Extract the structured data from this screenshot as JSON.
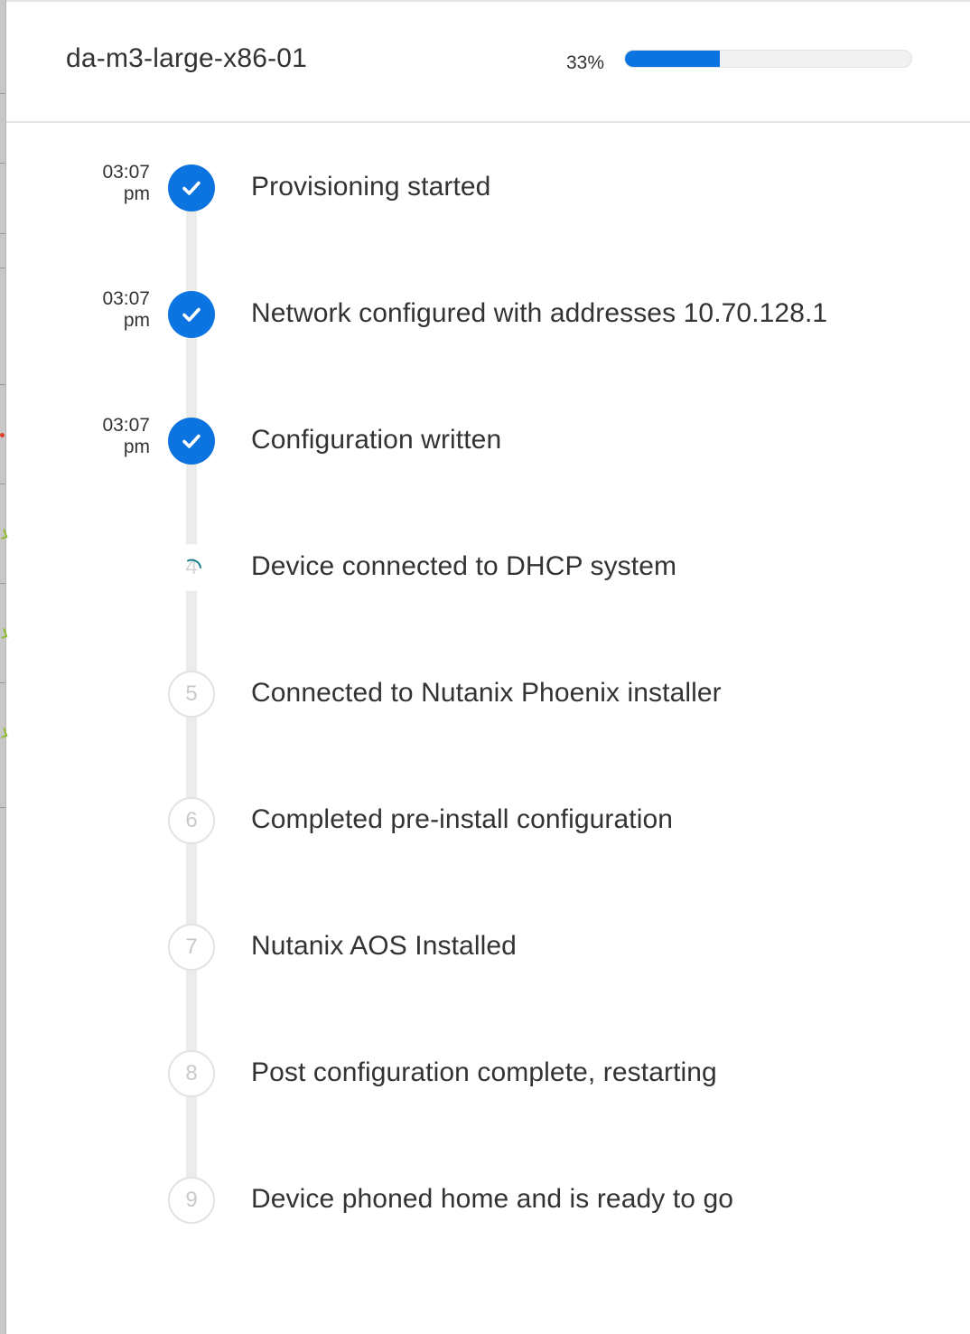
{
  "panel": {
    "device_name": "da-m3-large-x86-01",
    "progress": {
      "label": "33%",
      "fraction": 0.33,
      "color": "#0b74e0"
    }
  },
  "steps": [
    {
      "number": "1",
      "label": "Provisioning started",
      "time": "03:07",
      "meridiem": "pm",
      "status": "done"
    },
    {
      "number": "2",
      "label": "Network configured with addresses 10.70.128.1",
      "time": "03:07",
      "meridiem": "pm",
      "status": "done"
    },
    {
      "number": "3",
      "label": "Configuration written",
      "time": "03:07",
      "meridiem": "pm",
      "status": "done"
    },
    {
      "number": "4",
      "label": "Device connected to DHCP system",
      "time": "",
      "meridiem": "",
      "status": "active"
    },
    {
      "number": "5",
      "label": "Connected to Nutanix Phoenix installer",
      "time": "",
      "meridiem": "",
      "status": "pending"
    },
    {
      "number": "6",
      "label": "Completed pre-install configuration",
      "time": "",
      "meridiem": "",
      "status": "pending"
    },
    {
      "number": "7",
      "label": "Nutanix AOS Installed",
      "time": "",
      "meridiem": "",
      "status": "pending"
    },
    {
      "number": "8",
      "label": "Post configuration complete, restarting",
      "time": "",
      "meridiem": "",
      "status": "pending"
    },
    {
      "number": "9",
      "label": "Device phoned home and is ready to go",
      "time": "",
      "meridiem": "",
      "status": "pending"
    }
  ],
  "icons": {
    "done": "check-icon",
    "active": "spinner-icon"
  },
  "colors": {
    "accent": "#0b74e0",
    "spinner": "#1a7f8c",
    "text": "#333333"
  }
}
